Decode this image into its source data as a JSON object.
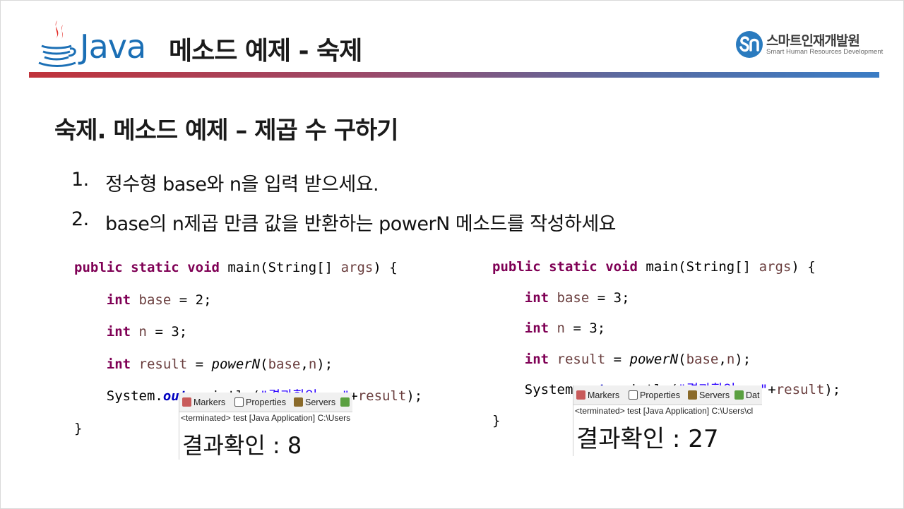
{
  "header": {
    "logo_text": "Java",
    "title": "메소드 예제 - 숙제",
    "brand_name": "스마트인재개발원",
    "brand_sub": "Smart Human Resources Development"
  },
  "section": {
    "title": "숙제. 메소드 예제 – 제곱 수 구하기",
    "items": [
      {
        "num": "1.",
        "text": "정수형 base와 n을 입력 받으세요."
      },
      {
        "num": "2.",
        "text": "base의 n제곱 만큼 값을 반환하는 powerN 메소드를 작성하세요"
      }
    ]
  },
  "code": {
    "kw_public": "public",
    "kw_static": "static",
    "kw_void": "void",
    "kw_int": "int",
    "main_sig": "main(String[] ",
    "args": "args",
    "open": ") {",
    "close": "}",
    "base": "base",
    "n": "n",
    "result": "result",
    "powerN": "powerN",
    "system": "System.",
    "out": "out",
    "println": ".println(",
    "string": "\"결과확인 : \"",
    "plus": "+",
    "end": ");",
    "example1": {
      "base_value": "2",
      "n_value": "3"
    },
    "example2": {
      "base_value": "3",
      "n_value": "3"
    }
  },
  "consoles": [
    {
      "tabs": [
        "Markers",
        "Properties",
        "Servers"
      ],
      "status": "<terminated> test [Java Application] C:\\Users",
      "result": "결과확인  :  8"
    },
    {
      "tabs": [
        "Markers",
        "Properties",
        "Servers",
        "Dat"
      ],
      "status": "<terminated> test [Java Application] C:\\Users\\cl",
      "result": "결과확인  :  27"
    }
  ],
  "colors": {
    "keyword": "#7f0055",
    "local_variable": "#6a3e3e",
    "string": "#2a00ff",
    "static_field": "#0000c0",
    "java_blue": "#1b6fb5",
    "bar_start": "#c0333b",
    "bar_end": "#3a7cc4"
  },
  "icons": [
    "java-coffee-cup-icon",
    "smhrd-logo-icon",
    "markers-icon",
    "properties-icon",
    "servers-icon",
    "data-icon"
  ]
}
